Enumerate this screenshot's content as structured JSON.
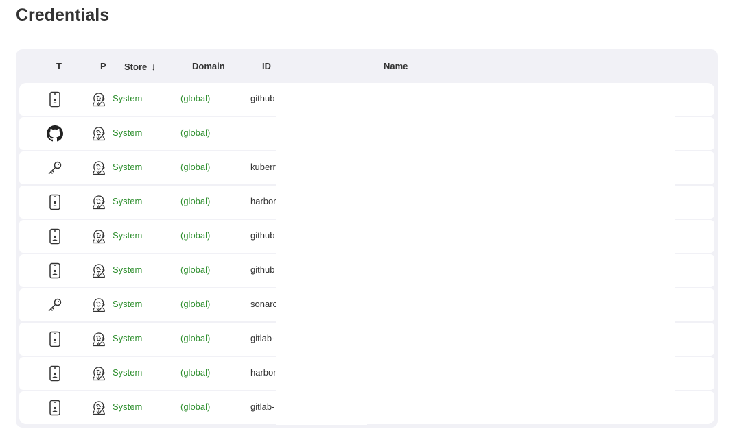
{
  "page": {
    "title": "Credentials"
  },
  "table": {
    "headers": {
      "type": "T",
      "provider": "P",
      "store": "Store",
      "store_sort_indicator": "↓",
      "domain": "Domain",
      "id": "ID",
      "name": "Name"
    },
    "rows": [
      {
        "type_icon": "mobile-icon",
        "provider_icon": "jenkins-icon",
        "store": "System",
        "domain": "(global)",
        "id": "github",
        "name": ""
      },
      {
        "type_icon": "github-icon",
        "provider_icon": "jenkins-icon",
        "store": "System",
        "domain": "(global)",
        "id": "",
        "name": ""
      },
      {
        "type_icon": "key-icon",
        "provider_icon": "jenkins-icon",
        "store": "System",
        "domain": "(global)",
        "id": "kuberr",
        "name": ""
      },
      {
        "type_icon": "mobile-icon",
        "provider_icon": "jenkins-icon",
        "store": "System",
        "domain": "(global)",
        "id": "harbor",
        "name": ""
      },
      {
        "type_icon": "mobile-icon",
        "provider_icon": "jenkins-icon",
        "store": "System",
        "domain": "(global)",
        "id": "github",
        "name": ""
      },
      {
        "type_icon": "mobile-icon",
        "provider_icon": "jenkins-icon",
        "store": "System",
        "domain": "(global)",
        "id": "github",
        "name": ""
      },
      {
        "type_icon": "key-icon",
        "provider_icon": "jenkins-icon",
        "store": "System",
        "domain": "(global)",
        "id": "sonarc",
        "name": ""
      },
      {
        "type_icon": "mobile-icon",
        "provider_icon": "jenkins-icon",
        "store": "System",
        "domain": "(global)",
        "id": "gitlab-",
        "name": ""
      },
      {
        "type_icon": "mobile-icon",
        "provider_icon": "jenkins-icon",
        "store": "System",
        "domain": "(global)",
        "id": "harbor",
        "name": ""
      },
      {
        "type_icon": "mobile-icon",
        "provider_icon": "jenkins-icon",
        "store": "System",
        "domain": "(global)",
        "id": "gitlab-",
        "name": ""
      }
    ]
  },
  "colors": {
    "link_green": "#2f8f2f",
    "panel_bg": "#f1f1f6",
    "row_bg": "#ffffff"
  }
}
